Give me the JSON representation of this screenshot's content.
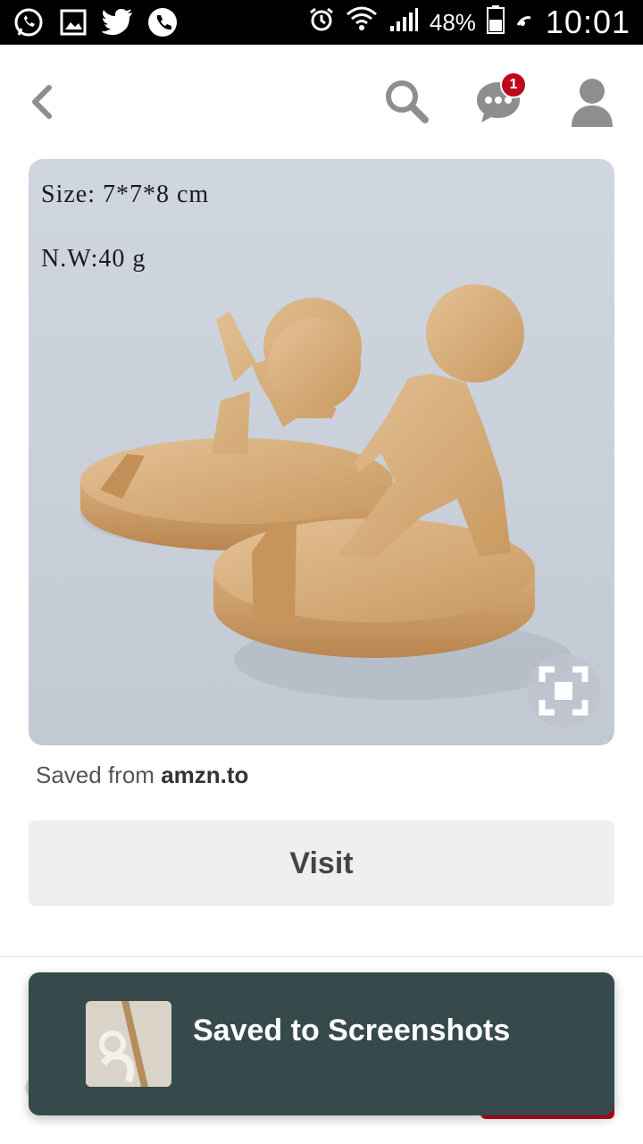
{
  "status_bar": {
    "left_icons": [
      "whatsapp-icon",
      "gallery-icon",
      "twitter-icon",
      "phone-icon"
    ],
    "right_icons": [
      "alarm-icon",
      "wifi-icon",
      "signal-icon"
    ],
    "battery": "48%",
    "time": "10:01"
  },
  "topbar": {
    "notification_count": "1"
  },
  "pin": {
    "image_text_size": "Size: 7*7*8 cm",
    "image_text_weight": "N.W:40 g",
    "saved_from_prefix": "Saved from",
    "saved_from_domain": "amzn.to",
    "visit_label": "Visit"
  },
  "toast": {
    "message": "Saved to Screenshots"
  },
  "colors": {
    "brand_red": "#bd081c",
    "toast_bg": "#364a4b",
    "icon_gray": "#8e8e8e"
  }
}
